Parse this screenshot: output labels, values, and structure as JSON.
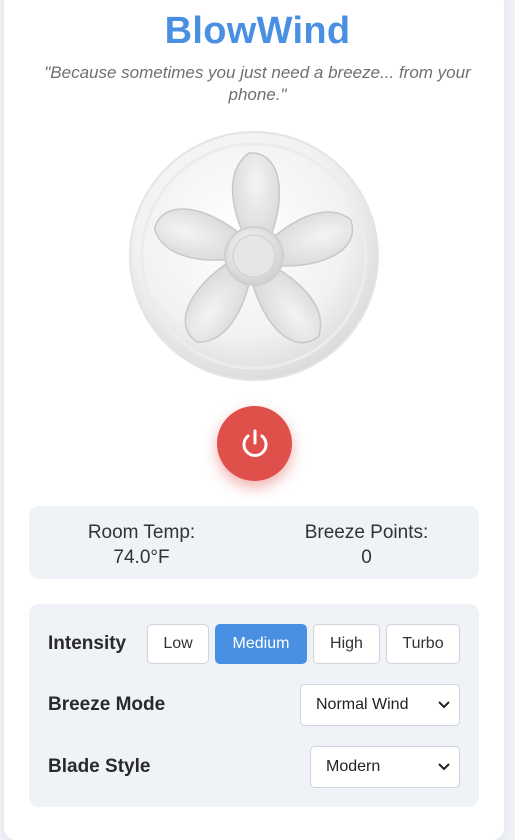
{
  "app": {
    "title": "BlowWind",
    "tagline": "\"Because sometimes you just need a breeze... from your phone.\""
  },
  "fan": {
    "icon": "fan-icon",
    "running": false
  },
  "power": {
    "icon": "power-icon",
    "color": "#e0504b"
  },
  "stats": {
    "room_temp_label": "Room Temp:",
    "room_temp_value": "74.0°F",
    "breeze_points_label": "Breeze Points:",
    "breeze_points_value": "0"
  },
  "controls": {
    "intensity": {
      "label": "Intensity",
      "options": [
        "Low",
        "Medium",
        "High",
        "Turbo"
      ],
      "selected": "Medium"
    },
    "breeze_mode": {
      "label": "Breeze Mode",
      "value": "Normal Wind"
    },
    "blade_style": {
      "label": "Blade Style",
      "value": "Modern"
    }
  },
  "colors": {
    "accent": "#4a90e2",
    "power": "#e0504b",
    "panel": "#eff2f7"
  }
}
